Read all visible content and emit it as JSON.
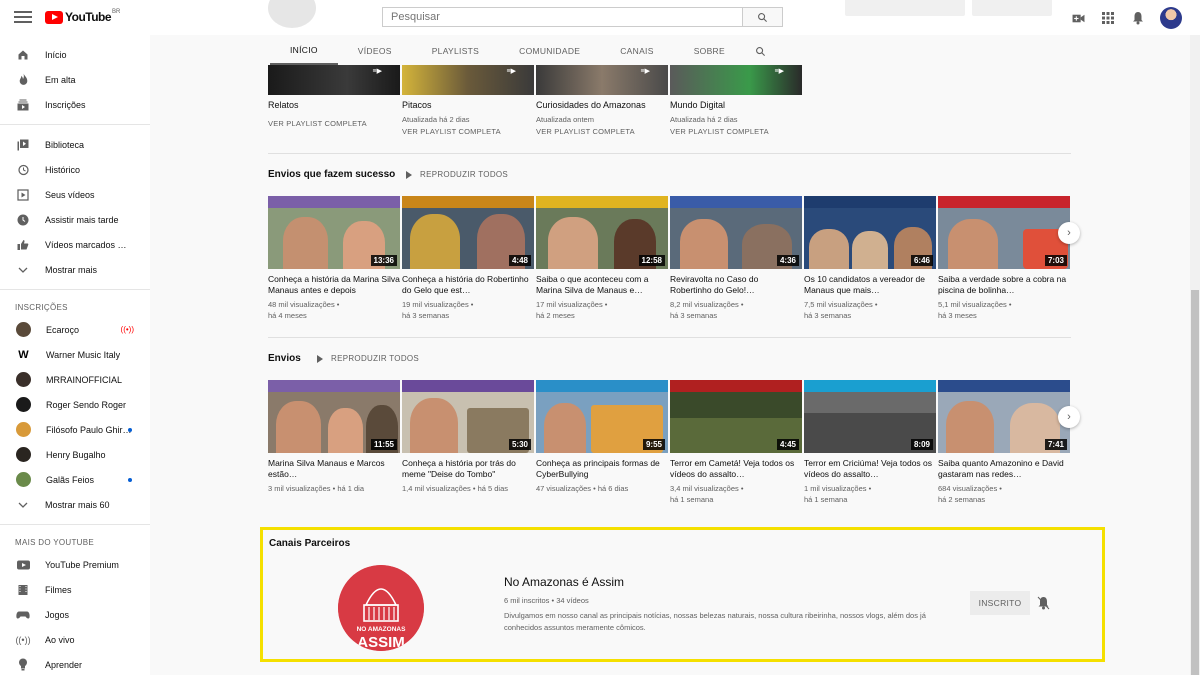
{
  "header": {
    "logo_text": "YouTube",
    "logo_country": "BR",
    "search_placeholder": "Pesquisar"
  },
  "sidebar": {
    "main_items": [
      {
        "label": "Início",
        "icon": "home-icon"
      },
      {
        "label": "Em alta",
        "icon": "fire-icon"
      },
      {
        "label": "Inscrições",
        "icon": "subscriptions-icon"
      }
    ],
    "library_items": [
      {
        "label": "Biblioteca",
        "icon": "library-icon"
      },
      {
        "label": "Histórico",
        "icon": "history-icon"
      },
      {
        "label": "Seus vídeos",
        "icon": "play-square-icon"
      },
      {
        "label": "Assistir mais tarde",
        "icon": "clock-icon"
      },
      {
        "label": "Vídeos marcados com \"Gostei\"",
        "icon": "thumbs-up-icon"
      },
      {
        "label": "Mostrar mais",
        "icon": "chevron-down-icon"
      }
    ],
    "subscriptions_heading": "INSCRIÇÕES",
    "subscriptions": [
      {
        "label": "Ecaroço",
        "live": true
      },
      {
        "label": "Warner Music Italy",
        "new": false
      },
      {
        "label": "MRRAINOFFICIAL",
        "new": false
      },
      {
        "label": "Roger Sendo Roger",
        "new": false
      },
      {
        "label": "Filósofo Paulo Ghiraldelli",
        "new": true
      },
      {
        "label": "Henry Bugalho",
        "new": false
      },
      {
        "label": "Galãs Feios",
        "new": true
      }
    ],
    "show_more_label": "Mostrar mais 60",
    "more_heading": "MAIS DO YOUTUBE",
    "more_items": [
      {
        "label": "YouTube Premium",
        "icon": "youtube-premium-icon"
      },
      {
        "label": "Filmes",
        "icon": "film-icon"
      },
      {
        "label": "Jogos",
        "icon": "gamepad-icon"
      },
      {
        "label": "Ao vivo",
        "icon": "live-icon"
      },
      {
        "label": "Aprender",
        "icon": "lightbulb-icon"
      }
    ]
  },
  "tabs": [
    "INÍCIO",
    "VÍDEOS",
    "PLAYLISTS",
    "COMUNIDADE",
    "CANAIS",
    "SOBRE"
  ],
  "playlists": [
    {
      "title": "Relatos",
      "updated": "",
      "link": "VER PLAYLIST COMPLETA"
    },
    {
      "title": "Pitacos",
      "updated": "Atualizada há 2 dias",
      "link": "VER PLAYLIST COMPLETA"
    },
    {
      "title": "Curiosidades do Amazonas",
      "updated": "Atualizada ontem",
      "link": "VER PLAYLIST COMPLETA"
    },
    {
      "title": "Mundo Digital",
      "updated": "Atualizada há 2 dias",
      "link": "VER PLAYLIST COMPLETA"
    }
  ],
  "shelf_popular": {
    "title": "Envios que fazem sucesso",
    "play_all": "REPRODUZIR TODOS",
    "videos": [
      {
        "title": "Conheça a história da Marina Silva Manaus antes e depois",
        "views": "48 mil visualizações •",
        "age": "há 4 meses",
        "duration": "13:36",
        "band": "#7b5fa8"
      },
      {
        "title": "Conheça a história do Robertinho do Gelo que est…",
        "views": "19 mil visualizações •",
        "age": "há 3 semanas",
        "duration": "4:48",
        "band": "#c9861a"
      },
      {
        "title": "Saiba o que aconteceu com a Marina Silva de Manaus e…",
        "views": "17 mil visualizações •",
        "age": "há 2 meses",
        "duration": "12:58",
        "band": "#e0b420"
      },
      {
        "title": "Reviravolta no Caso do Robertinho do Gelo!…",
        "views": "8,2 mil visualizações •",
        "age": "há 3 semanas",
        "duration": "4:36",
        "band": "#3a5ca8"
      },
      {
        "title": "Os 10 candidatos a vereador de Manaus que mais…",
        "views": "7,5 mil visualizações •",
        "age": "há 3 semanas",
        "duration": "6:46",
        "band": "#1e3c6e"
      },
      {
        "title": "Saiba a verdade sobre a cobra na piscina de bolinha…",
        "views": "5,1 mil visualizações •",
        "age": "há 3 meses",
        "duration": "7:03",
        "band": "#c8242c"
      }
    ]
  },
  "shelf_uploads": {
    "title": "Envios",
    "play_all": "REPRODUZIR TODOS",
    "videos": [
      {
        "title": "Marina Silva Manaus e Marcos estão…",
        "views": "3 mil visualizações • há 1 dia",
        "age": "",
        "duration": "11:55",
        "band": "#7b5fa8"
      },
      {
        "title": "Conheça a história por trás do meme \"Deise do Tombo\"",
        "views": "1,4 mil visualizações • há 5 dias",
        "age": "",
        "duration": "5:30",
        "band": "#6a4a9a"
      },
      {
        "title": "Conheça as principais formas de CyberBullying",
        "views": "47 visualizações • há 6 dias",
        "age": "",
        "duration": "9:55",
        "band": "#2a8fc8"
      },
      {
        "title": "Terror em Cametá! Veja todos os vídeos do assalto…",
        "views": "3,4 mil visualizações •",
        "age": "há 1 semana",
        "duration": "4:45",
        "band": "#b02020"
      },
      {
        "title": "Terror em Criciúma! Veja todos os vídeos do assalto…",
        "views": "1 mil visualizações •",
        "age": "há 1 semana",
        "duration": "8:09",
        "band": "#1a9fd0"
      },
      {
        "title": "Saiba quanto Amazonino e David gastaram nas redes…",
        "views": "684 visualizações •",
        "age": "há 2 semanas",
        "duration": "7:41",
        "band": "#2b4c8c"
      }
    ]
  },
  "partner": {
    "section_title": "Canais Parceiros",
    "channel_name": "No Amazonas é Assim",
    "stats": "6 mil inscritos • 34 vídeos",
    "description": "Divulgamos em nosso canal as principais notícias, nossas belezas naturais, nossa cultura ribeirinha, nossos vlogs, além dos já conhecidos assuntos meramente cômicos.",
    "avatar_text_line1": "NO AMAZONAS",
    "avatar_text_line2": "ASSIM",
    "subscribe_label": "INSCRITO",
    "accent_color": "#d83a44",
    "highlight_color": "#f5e000"
  }
}
